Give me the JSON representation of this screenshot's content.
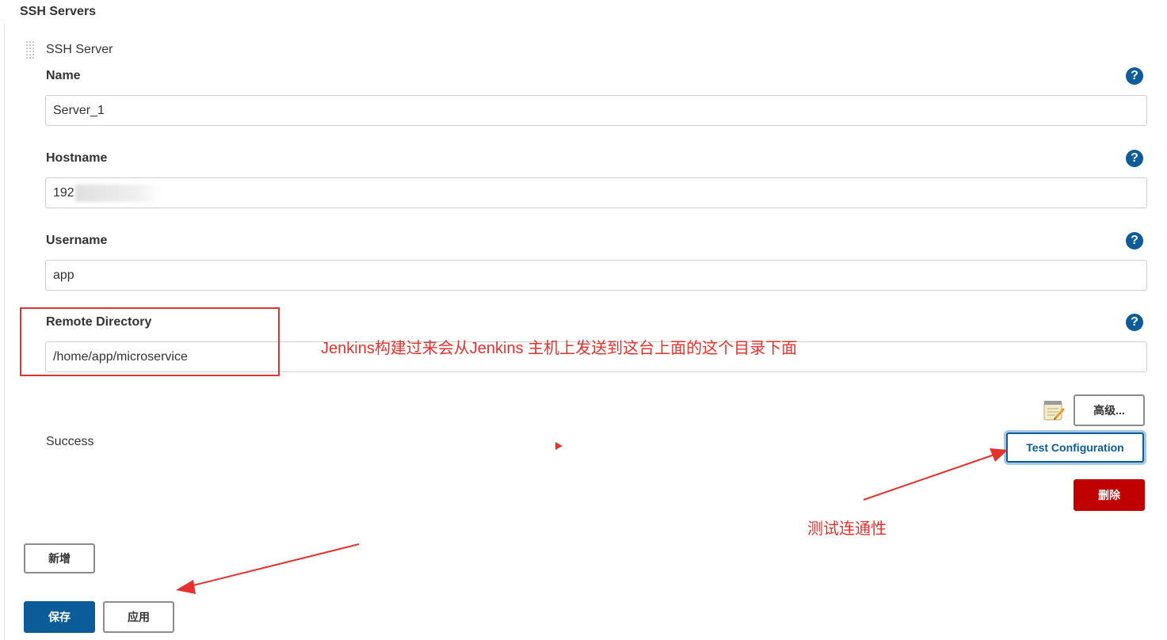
{
  "section": {
    "title": "SSH Servers"
  },
  "server": {
    "label": "SSH Server",
    "fields": {
      "name": {
        "label": "Name",
        "value": "Server_1"
      },
      "hostname": {
        "label": "Hostname",
        "value": "192"
      },
      "username": {
        "label": "Username",
        "value": "app"
      },
      "remote_directory": {
        "label": "Remote Directory",
        "value": "/home/app/microservice"
      }
    },
    "help_label": "?",
    "status": "Success",
    "buttons": {
      "advanced": "高级...",
      "test_configuration": "Test Configuration",
      "delete": "删除"
    }
  },
  "footer": {
    "add": "新增",
    "save": "保存",
    "apply": "应用"
  },
  "annotations": {
    "remote_dir_note": "Jenkins构建过来会从Jenkins 主机上发送到这台上面的这个目录下面",
    "test_note": "测试连通性"
  },
  "colors": {
    "primary": "#0b5c99",
    "danger": "#c00000",
    "annotation": "#e5322e"
  },
  "icons": [
    "drag-handle-icon",
    "help-icon",
    "notepad-icon",
    "arrow-icon"
  ]
}
